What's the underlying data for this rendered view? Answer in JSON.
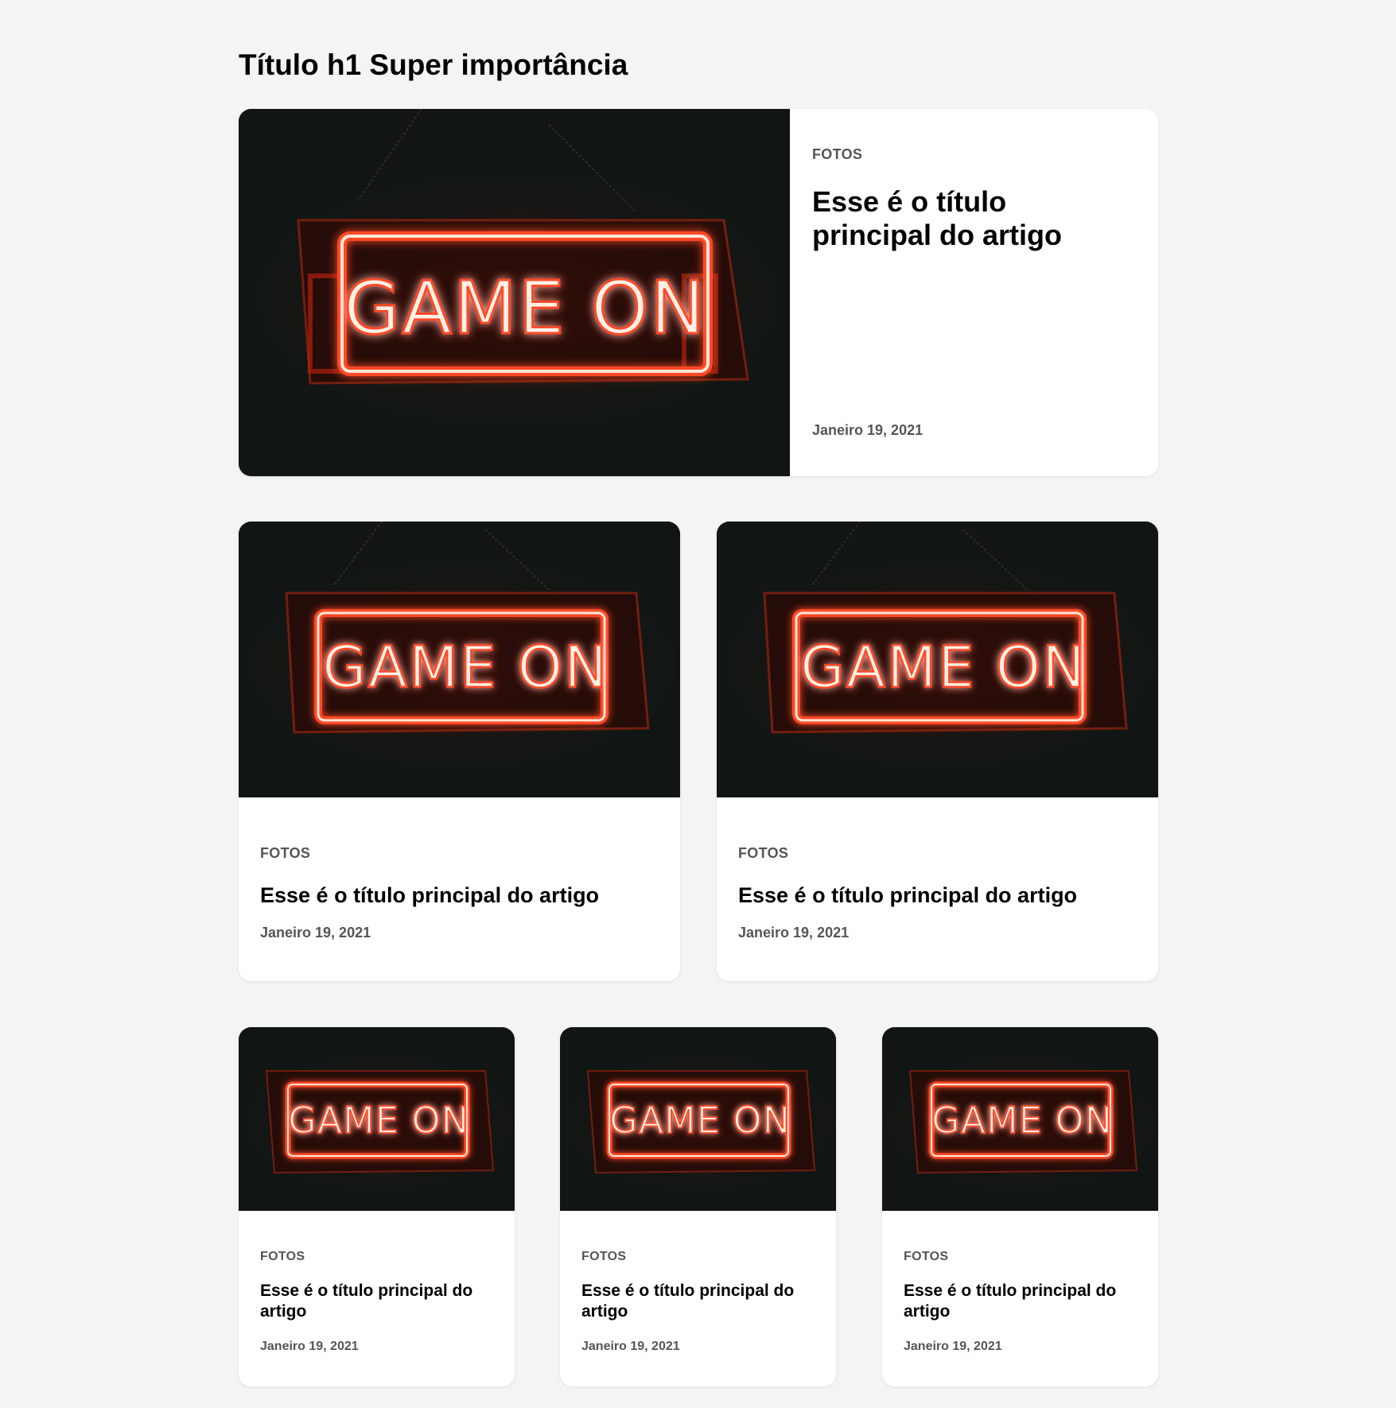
{
  "page": {
    "title": "Título h1 Super importância"
  },
  "sign_text": "GAME ON",
  "hero": {
    "category": "FOTOS",
    "title": "Esse é o título principal do artigo",
    "date": "Janeiro 19, 2021"
  },
  "row2": [
    {
      "category": "FOTOS",
      "title": "Esse é o título principal do artigo",
      "date": "Janeiro 19, 2021"
    },
    {
      "category": "FOTOS",
      "title": "Esse é o título principal do artigo",
      "date": "Janeiro 19, 2021"
    }
  ],
  "row3": [
    {
      "category": "FOTOS",
      "title": "Esse é o título principal do artigo",
      "date": "Janeiro 19, 2021"
    },
    {
      "category": "FOTOS",
      "title": "Esse é o título principal do artigo",
      "date": "Janeiro 19, 2021"
    },
    {
      "category": "FOTOS",
      "title": "Esse é o título principal do artigo",
      "date": "Janeiro 19, 2021"
    }
  ],
  "colors": {
    "background": "#f4f4f6",
    "card": "#ffffff",
    "image_bg": "#111614",
    "neon_red": "#ff3b1f",
    "neon_core": "#fff1e6",
    "muted_text": "#555555"
  }
}
